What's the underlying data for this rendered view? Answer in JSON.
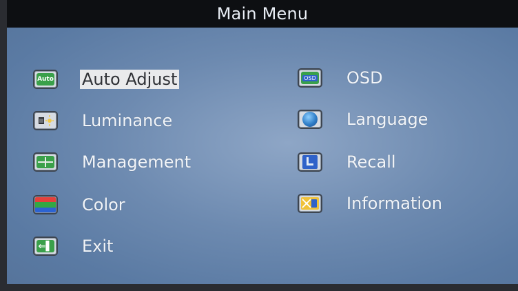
{
  "window": {
    "title": "Main Menu"
  },
  "colors": {
    "panel_base": "#6d8ab0",
    "title_bg": "#0d0f12",
    "label_text": "#f2f5f9",
    "selection_bg": "#e9eaec",
    "selection_text": "#2f3136"
  },
  "menu": {
    "left": [
      {
        "label": "Auto Adjust",
        "icon": "auto-adjust-icon",
        "selected": true
      },
      {
        "label": "Luminance",
        "icon": "luminance-icon",
        "selected": false
      },
      {
        "label": "Management",
        "icon": "management-icon",
        "selected": false
      },
      {
        "label": "Color",
        "icon": "color-bars-icon",
        "selected": false
      },
      {
        "label": "Exit",
        "icon": "exit-door-icon",
        "selected": false
      }
    ],
    "right": [
      {
        "label": "OSD",
        "icon": "osd-icon",
        "selected": false
      },
      {
        "label": "Language",
        "icon": "globe-icon",
        "selected": false
      },
      {
        "label": "Recall",
        "icon": "recall-icon",
        "selected": false
      },
      {
        "label": "Information",
        "icon": "information-icon",
        "selected": false
      }
    ]
  },
  "icons": {
    "auto_text": "Auto",
    "osd_text": "OSD",
    "exit_text": "⇐▌"
  }
}
